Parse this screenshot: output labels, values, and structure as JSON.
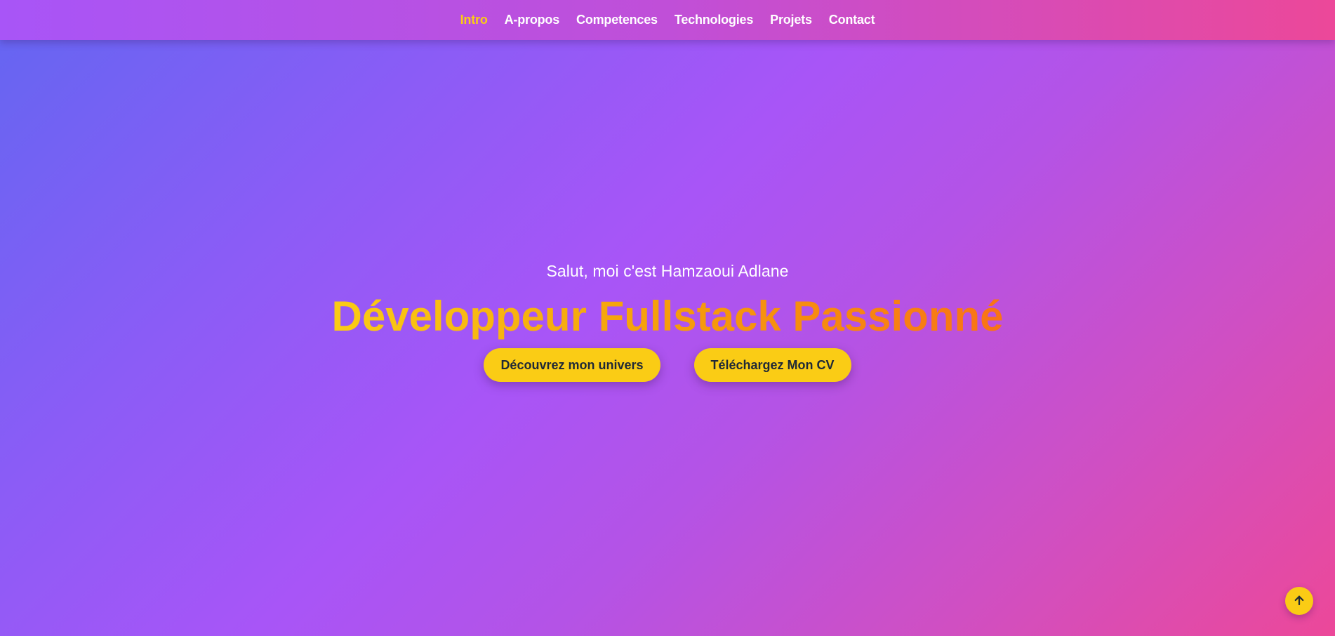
{
  "nav": {
    "items": [
      {
        "label": "Intro",
        "active": true
      },
      {
        "label": "A-propos",
        "active": false
      },
      {
        "label": "Competences",
        "active": false
      },
      {
        "label": "Technologies",
        "active": false
      },
      {
        "label": "Projets",
        "active": false
      },
      {
        "label": "Contact",
        "active": false
      }
    ]
  },
  "hero": {
    "intro": "Salut, moi c'est Hamzaoui Adlane",
    "title": "Développeur Fullstack Passionné",
    "buttons": {
      "discover_label": "Découvrez mon univers",
      "download_cv_label": "Téléchargez Mon CV"
    }
  },
  "scroll_top": {
    "icon": "arrow-up-icon"
  },
  "colors": {
    "accent": "#facc15",
    "accent_text": "#1f2937",
    "gradient_start": "#6366f1",
    "gradient_mid": "#a855f7",
    "gradient_end": "#ec4899",
    "title_gradient_start": "#facc15",
    "title_gradient_end": "#f97316"
  }
}
